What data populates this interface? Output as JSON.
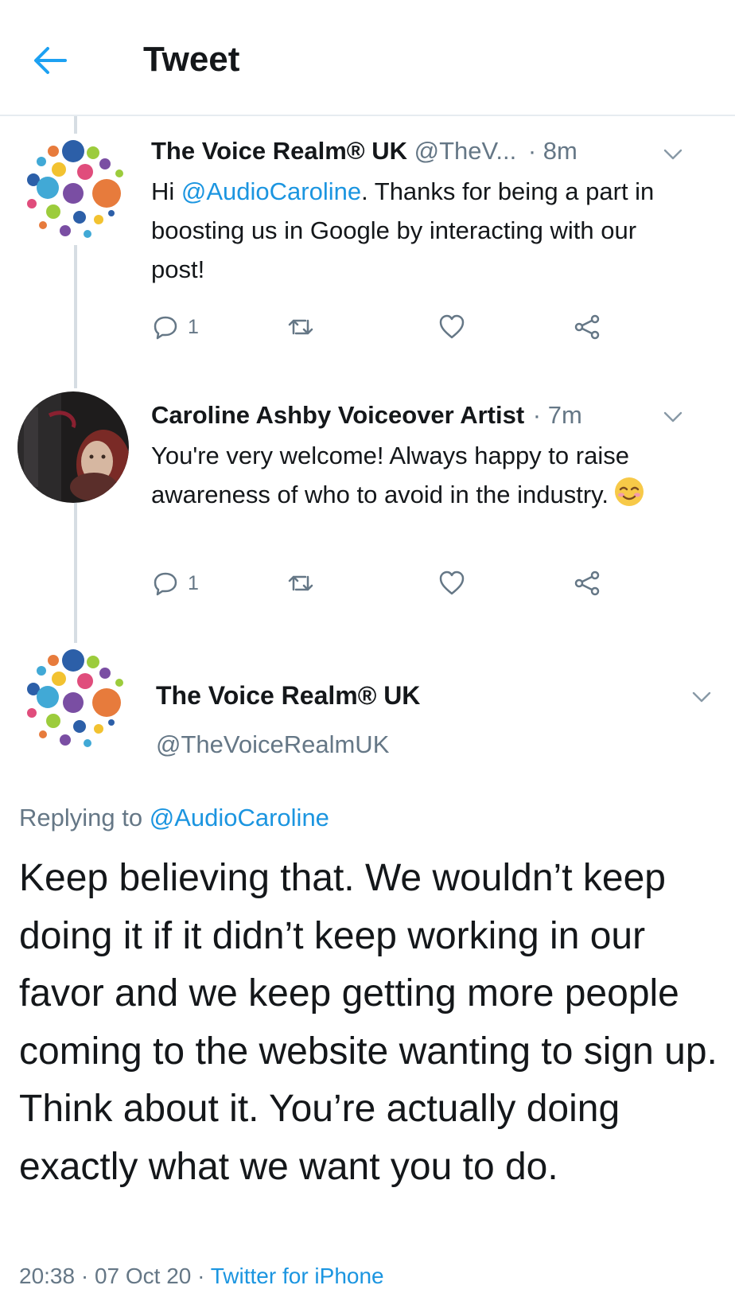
{
  "header": {
    "title": "Tweet",
    "back_icon": "arrow-left-icon",
    "accent": "#1da1f2"
  },
  "tweets": [
    {
      "display_name": "The Voice Realm® UK",
      "handle": "@TheV...",
      "time": "· 8m",
      "text_prefix": "Hi ",
      "mention": "@AudioCaroline",
      "text_suffix": ". Thanks for being a part in boosting us in Google by interacting with our post!",
      "reply_count": "1"
    },
    {
      "display_name": "Caroline Ashby Voiceover Artist",
      "time": "· 7m",
      "text": "You're very welcome! Always happy to raise awareness of who to avoid in the industry.",
      "emoji": "smiling-face-emoji",
      "reply_count": "1"
    }
  ],
  "main_tweet": {
    "display_name": "The Voice Realm® UK",
    "handle": "@TheVoiceRealmUK",
    "replying_label": "Replying to ",
    "replying_mention": "@AudioCaroline",
    "text": "Keep believing that. We wouldn’t keep doing it if it didn’t keep working in our favor and we keep getting more people coming to the website wanting to sign up. Think about it. You’re actually doing exactly what we want you to do.",
    "timestamp": "20:38 · 07 Oct 20 · ",
    "source": "Twitter for iPhone"
  },
  "colors": {
    "link": "#1b95e0",
    "secondary_text": "#657786",
    "primary_text": "#14171a",
    "divider": "#e6ecf0"
  }
}
